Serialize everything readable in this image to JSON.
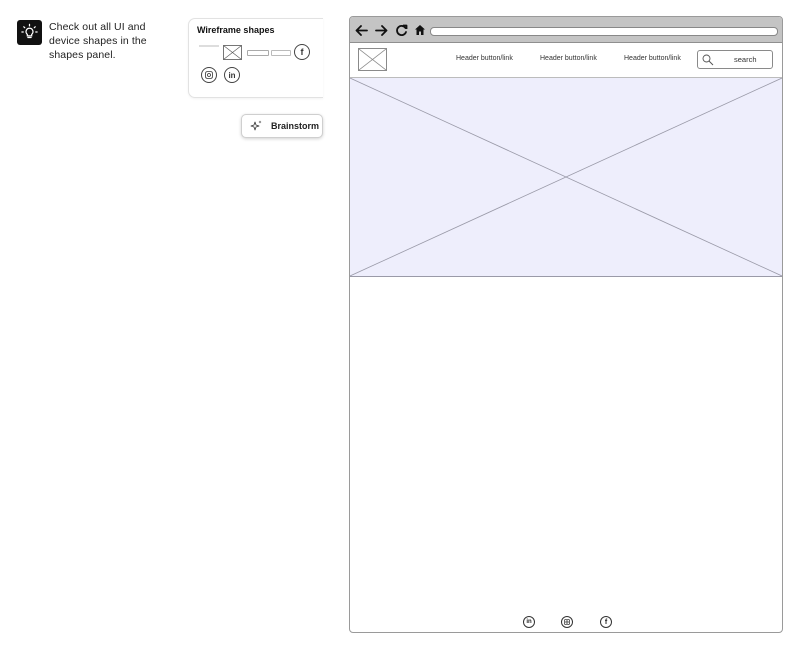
{
  "tip": {
    "icon": "lightbulb-icon",
    "text": "Check out all UI and device shapes in the shapes panel."
  },
  "shapes_card": {
    "title": "Wireframe shapes",
    "icons": [
      "image-placeholder-icon",
      "facebook-icon",
      "instagram-icon",
      "linkedin-icon"
    ]
  },
  "brainstorm": {
    "label": "Brainstorm",
    "icon": "sparkle-icon"
  },
  "browser": {
    "nav_icons": [
      "back-arrow-icon",
      "forward-arrow-icon",
      "reload-icon",
      "home-icon"
    ],
    "header_links": [
      "Header button/link",
      "Header button/link",
      "Header button/link"
    ],
    "search_placeholder": "search",
    "footer_icons": [
      "linkedin-icon",
      "instagram-icon",
      "facebook-icon"
    ],
    "hero_color": "#eeeefc"
  }
}
